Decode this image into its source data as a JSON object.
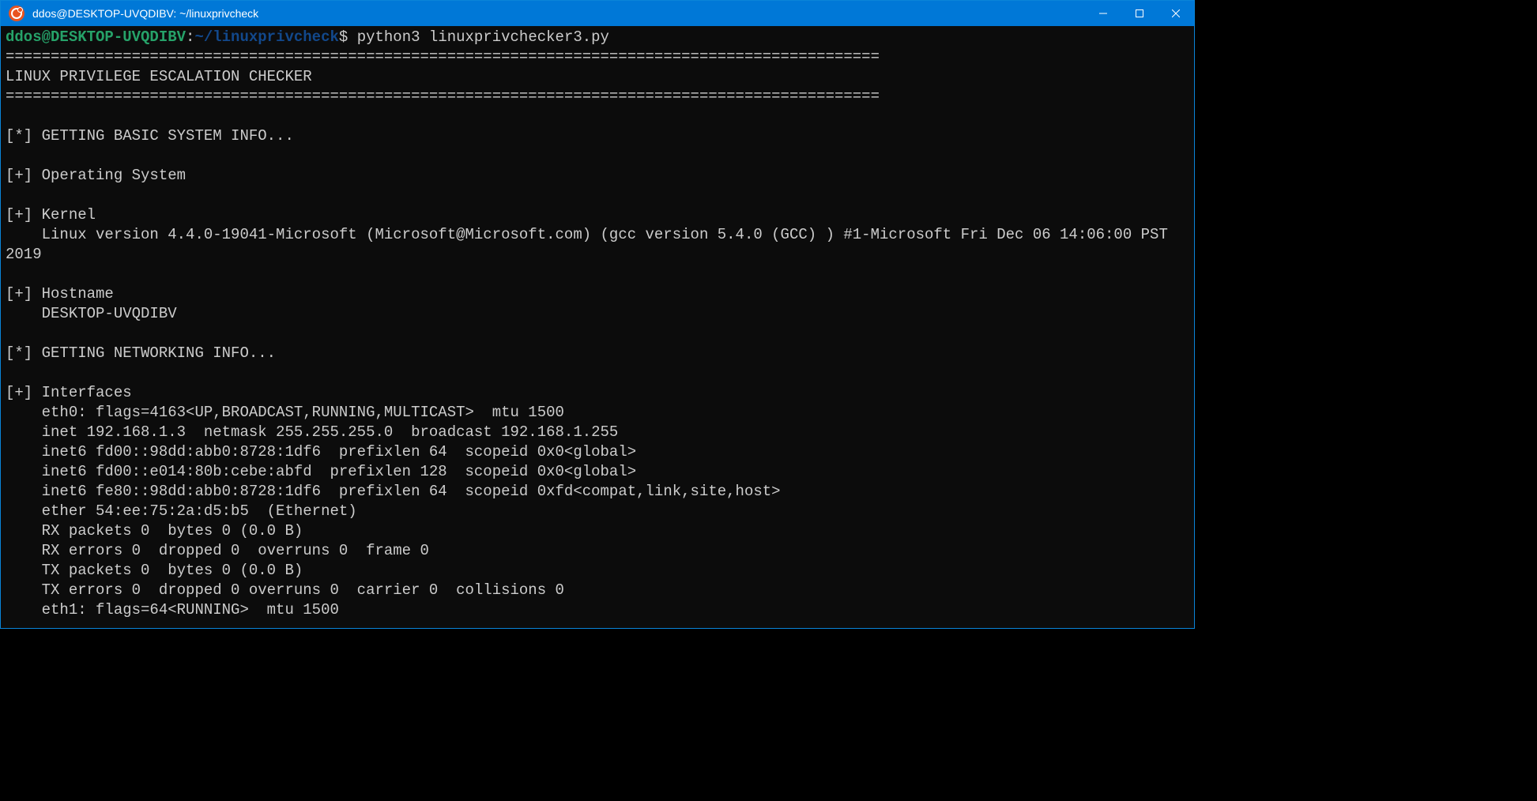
{
  "window": {
    "title": "ddos@DESKTOP-UVQDIBV: ~/linuxprivcheck"
  },
  "prompt": {
    "user": "ddos",
    "at": "@",
    "host": "DESKTOP-UVQDIBV",
    "colon": ":",
    "path": "~/linuxprivcheck",
    "dollar": "$"
  },
  "command": "python3 linuxprivchecker3.py",
  "output": {
    "sep1": "=================================================================================================",
    "title": "LINUX PRIVILEGE ESCALATION CHECKER",
    "sep2": "=================================================================================================",
    "blank1": "",
    "l1": "[*] GETTING BASIC SYSTEM INFO...",
    "blank2": "",
    "l2": "[+] Operating System",
    "blank3": "",
    "l3": "[+] Kernel",
    "l4": "    Linux version 4.4.0-19041-Microsoft (Microsoft@Microsoft.com) (gcc version 5.4.0 (GCC) ) #1-Microsoft Fri Dec 06 14:06:00 PST 2019",
    "blank4": "",
    "l5": "[+] Hostname",
    "l6": "    DESKTOP-UVQDIBV",
    "blank5": "",
    "l7": "[*] GETTING NETWORKING INFO...",
    "blank6": "",
    "l8": "[+] Interfaces",
    "l9": "    eth0: flags=4163<UP,BROADCAST,RUNNING,MULTICAST>  mtu 1500",
    "l10": "    inet 192.168.1.3  netmask 255.255.255.0  broadcast 192.168.1.255",
    "l11": "    inet6 fd00::98dd:abb0:8728:1df6  prefixlen 64  scopeid 0x0<global>",
    "l12": "    inet6 fd00::e014:80b:cebe:abfd  prefixlen 128  scopeid 0x0<global>",
    "l13": "    inet6 fe80::98dd:abb0:8728:1df6  prefixlen 64  scopeid 0xfd<compat,link,site,host>",
    "l14": "    ether 54:ee:75:2a:d5:b5  (Ethernet)",
    "l15": "    RX packets 0  bytes 0 (0.0 B)",
    "l16": "    RX errors 0  dropped 0  overruns 0  frame 0",
    "l17": "    TX packets 0  bytes 0 (0.0 B)",
    "l18": "    TX errors 0  dropped 0 overruns 0  carrier 0  collisions 0",
    "l19": "    eth1: flags=64<RUNNING>  mtu 1500"
  }
}
